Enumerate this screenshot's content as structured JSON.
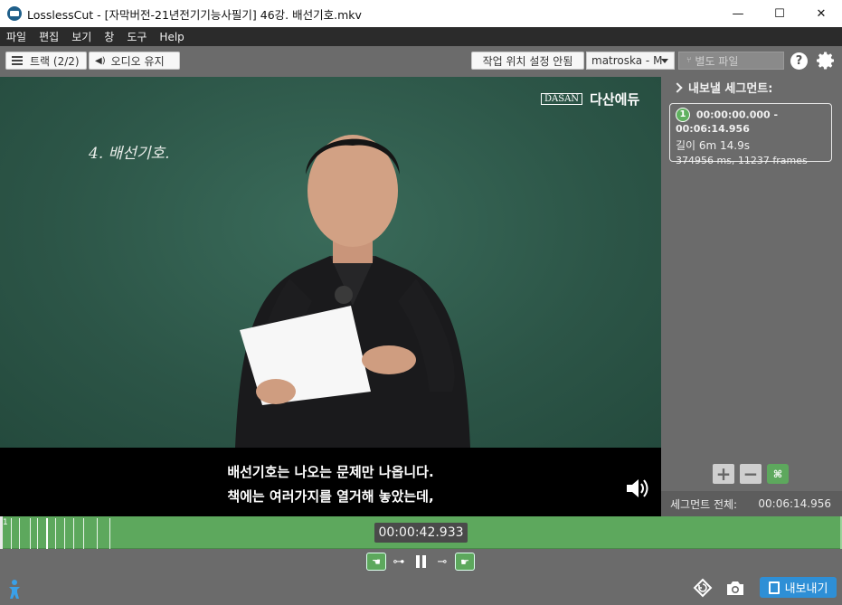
{
  "window": {
    "title": "LosslessCut - [자막버전-21년전기기능사필기] 46강. 배선기호.mkv",
    "minimize": "—",
    "maximize": "☐",
    "close": "✕"
  },
  "menu": [
    "파일",
    "편집",
    "보기",
    "창",
    "도구",
    "Help"
  ],
  "toolbar": {
    "tracks_label": "트랙 (2/2)",
    "audio_label": "오디오 유지",
    "work_pos_label": "작업 위치 설정 안됨",
    "format_value": "matroska - M",
    "separate_file_label": "별도 파일",
    "help_label": "?"
  },
  "video": {
    "logo_box": "DASAN",
    "logo_name": "다산에듀",
    "chalk_text": "4. 배선기호.",
    "subtitle_line1": "배선기호는 나오는 문제만 나옵니다.",
    "subtitle_line2": "책에는 여러가지를 열거해 놓았는데,"
  },
  "panel": {
    "header": "내보낼 세그먼트:",
    "segment": {
      "number": "1",
      "time_range": "00:00:00.000 - 00:06:14.956",
      "duration": "길이 6m 14.9s",
      "details": "374956 ms, 11237 frames"
    },
    "total_label": "세그먼트 전체:",
    "total_value": "00:06:14.956",
    "split_label": "⌘"
  },
  "timeline": {
    "segment_number": "1",
    "current_time": "00:00:42.933"
  },
  "export": {
    "label": "내보내기"
  },
  "colors": {
    "timeline_green": "#5da85d",
    "export_blue": "#2e8fd6",
    "panel_gray": "#6b6b6b"
  }
}
